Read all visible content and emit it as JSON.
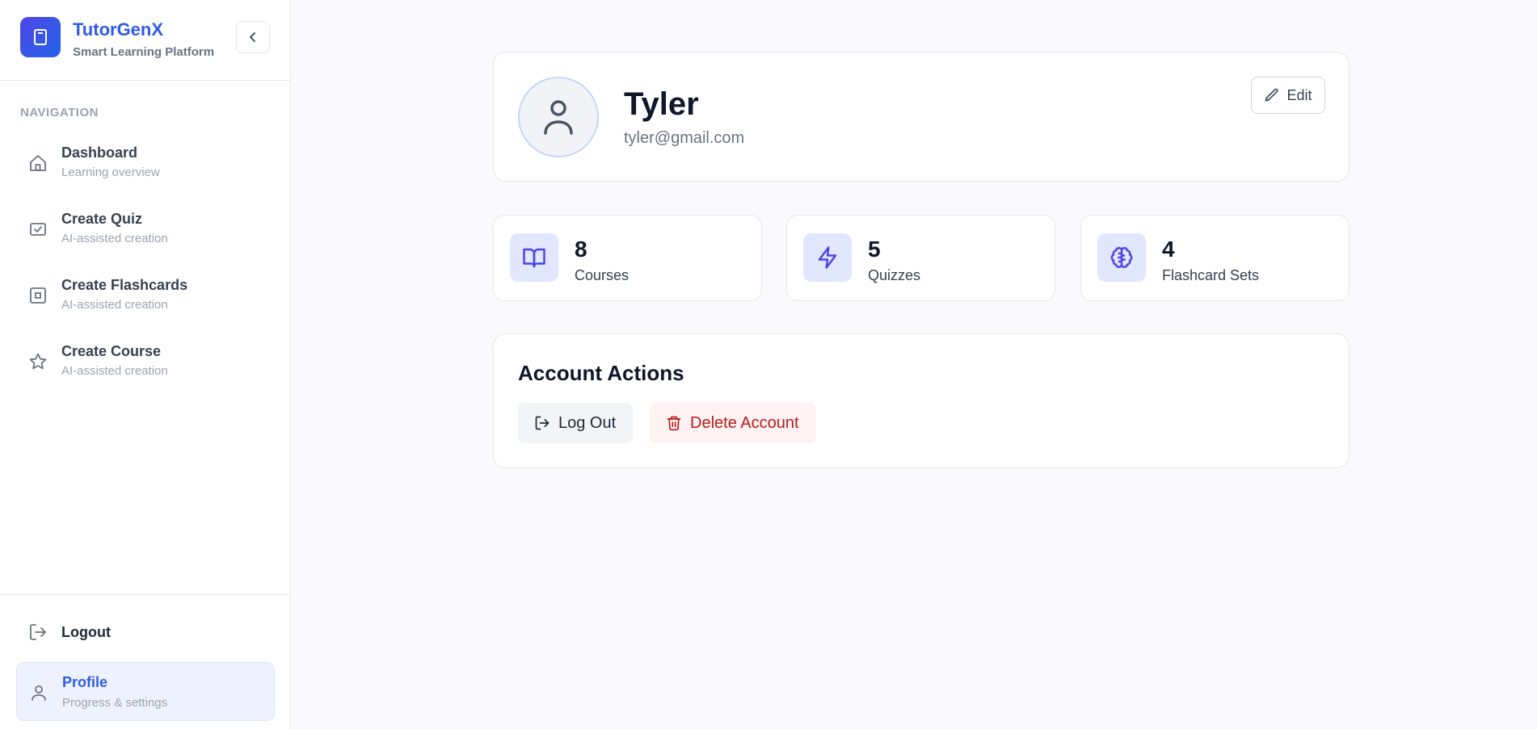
{
  "brand": {
    "name": "TutorGenX",
    "subtitle": "Smart Learning Platform"
  },
  "navigation": {
    "heading": "NAVIGATION",
    "items": [
      {
        "label": "Dashboard",
        "sub": "Learning overview",
        "icon": "home-icon"
      },
      {
        "label": "Create Quiz",
        "sub": "AI-assisted creation",
        "icon": "checkbox-icon"
      },
      {
        "label": "Create Flashcards",
        "sub": "AI-assisted creation",
        "icon": "square-icon"
      },
      {
        "label": "Create Course",
        "sub": "AI-assisted creation",
        "icon": "star-icon"
      }
    ]
  },
  "footer_nav": {
    "logout": "Logout",
    "profile": {
      "label": "Profile",
      "sub": "Progress & settings"
    }
  },
  "profile": {
    "name": "Tyler",
    "email": "tyler@gmail.com",
    "edit_label": "Edit"
  },
  "stats": [
    {
      "value": "8",
      "label": "Courses",
      "icon": "book-icon"
    },
    {
      "value": "5",
      "label": "Quizzes",
      "icon": "lightning-icon"
    },
    {
      "value": "4",
      "label": "Flashcard Sets",
      "icon": "brain-icon"
    }
  ],
  "account_actions": {
    "title": "Account Actions",
    "logout_label": "Log Out",
    "delete_label": "Delete Account"
  },
  "colors": {
    "brand": "#2f5bea",
    "accent_bg": "#e0e7ff",
    "icon_accent": "#4f46e5",
    "danger": "#b91c1c",
    "danger_bg": "#fef2f2"
  }
}
